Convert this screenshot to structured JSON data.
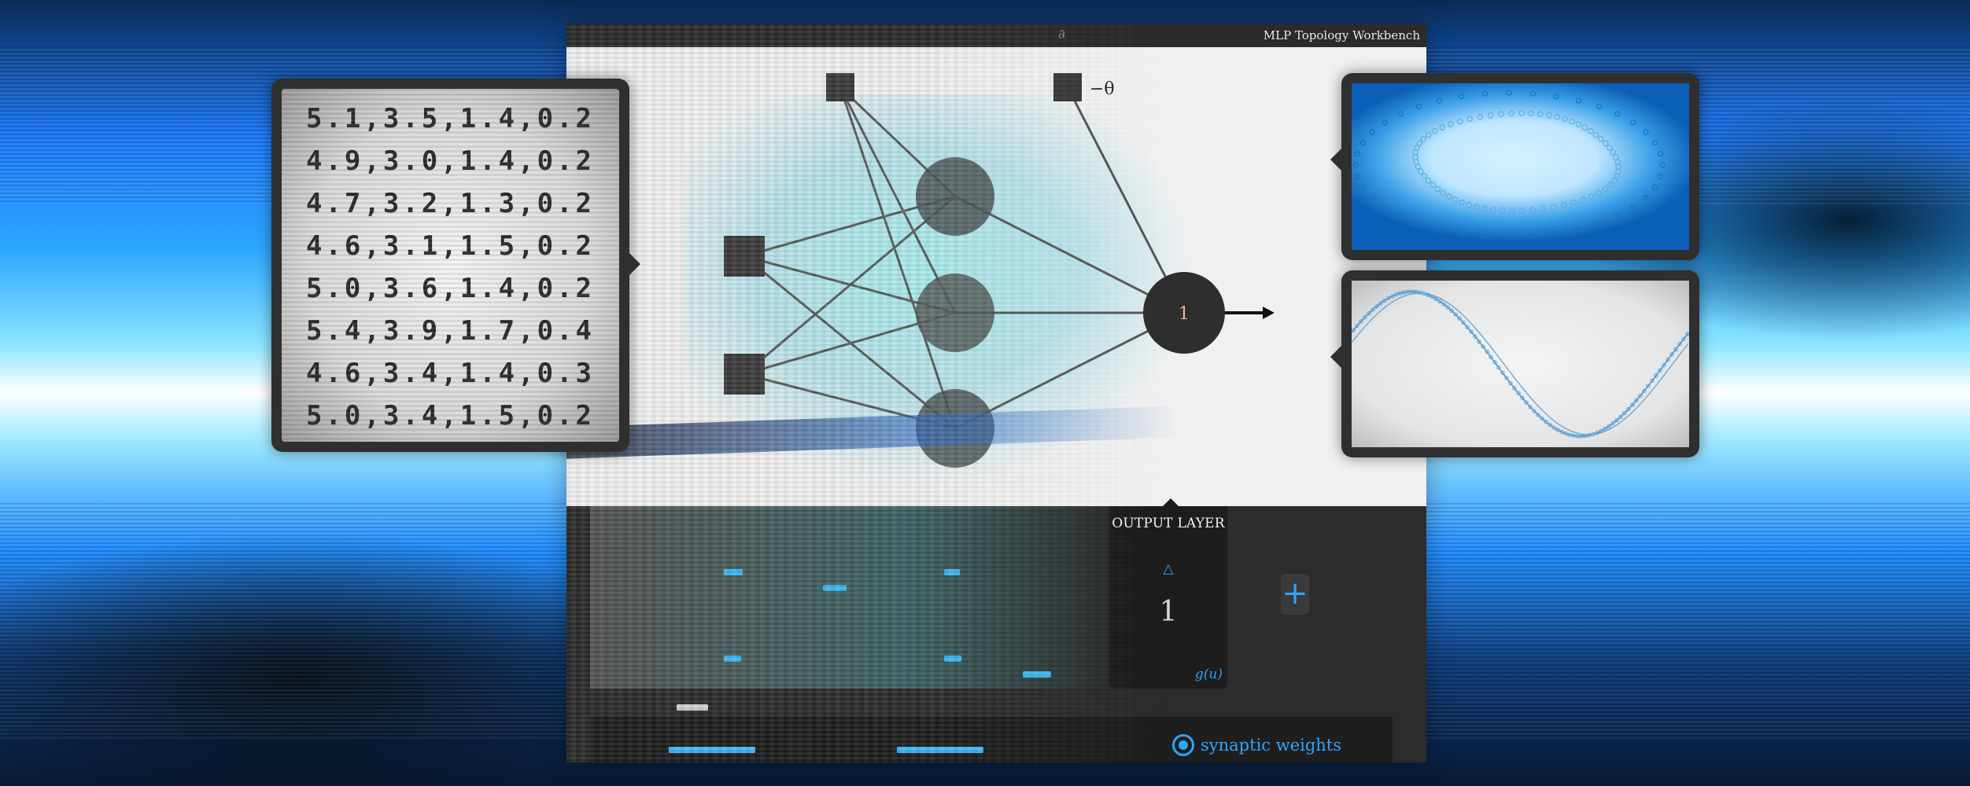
{
  "window": {
    "title": "MLP Topology Workbench",
    "logo_glyph": "∂"
  },
  "network": {
    "bias_label": "−θ",
    "output_neuron_label": "1",
    "inputs": 2,
    "hidden": 3,
    "outputs": 1
  },
  "layer_panel": {
    "heading": "OUTPUT LAYER",
    "increment_icon": "triangle-up-icon",
    "neuron_count": "1",
    "activation": "g(u)",
    "add_icon": "plus-icon"
  },
  "options": {
    "weights_label": "synaptic weights",
    "weights_selected": true
  },
  "dataset": {
    "rows": [
      "5.1,3.5,1.4,0.2",
      "4.9,3.0,1.4,0.2",
      "4.7,3.2,1.3,0.2",
      "4.6,3.1,1.5,0.2",
      "5.0,3.6,1.4,0.2",
      "5.4,3.9,1.7,0.4",
      "4.6,3.4,1.4,0.3",
      "5.0,3.4,1.5,0.2"
    ]
  },
  "colors": {
    "accent": "#2fa4ff",
    "panel": "#2f2f2f",
    "dark": "#1d1d1d"
  }
}
